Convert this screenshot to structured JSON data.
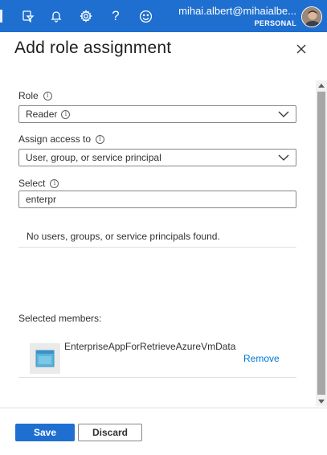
{
  "topbar": {
    "email": "mihai.albert@mihaialbe...",
    "directory": "PERSONAL",
    "icons": [
      "cloud-shell-icon",
      "directory-filter-icon",
      "notifications-bell-icon",
      "settings-gear-icon",
      "help-icon",
      "feedback-smiley-icon",
      "user-avatar"
    ],
    "help_glyph": "?"
  },
  "panel": {
    "title": "Add role assignment",
    "close_icon": "close-icon"
  },
  "form": {
    "role": {
      "label": "Role",
      "value": "Reader"
    },
    "assign_access": {
      "label": "Assign access to",
      "value": "User, group, or service principal"
    },
    "select": {
      "label": "Select",
      "value": "enterpr"
    },
    "no_results_text": "No users, groups, or service principals found.",
    "selected_members_label": "Selected members:",
    "selected_members": [
      {
        "name": "EnterpriseAppForRetrieveAzureVmData",
        "remove_label": "Remove",
        "icon": "app-registration-icon"
      }
    ],
    "info_glyph": "i"
  },
  "footer": {
    "save_label": "Save",
    "discard_label": "Discard"
  },
  "colors": {
    "accent": "#1f6fd0",
    "link": "#0078d4",
    "border": "#8a8886"
  }
}
